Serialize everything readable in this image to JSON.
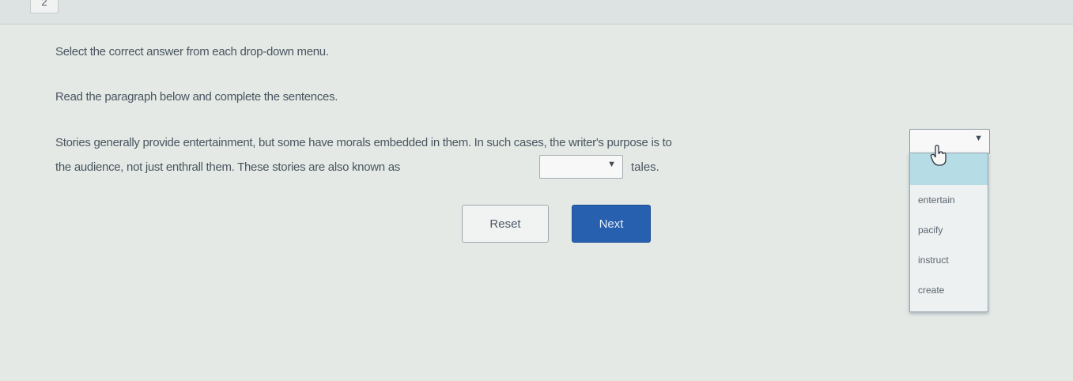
{
  "question": {
    "number": "2"
  },
  "instructions": {
    "line1": "Select the correct answer from each drop-down menu.",
    "line2": "Read the paragraph below and complete the sentences."
  },
  "paragraph": {
    "part1": "Stories generally provide entertainment, but some have morals embedded in them. In such cases, the writer's purpose is to",
    "part2": "the audience, not just enthrall them. These stories are also known as",
    "part3": "tales."
  },
  "dropdown1": {
    "selected": "",
    "options": [
      "entertain",
      "pacify",
      "instruct",
      "create"
    ]
  },
  "dropdown2": {
    "selected": ""
  },
  "buttons": {
    "reset": "Reset",
    "next": "Next"
  },
  "icons": {
    "chevron": "chevron-down-icon",
    "cursor": "hand-pointer-icon"
  },
  "colors": {
    "next_button": "#2860b0",
    "highlight_option": "#b6dce6"
  }
}
